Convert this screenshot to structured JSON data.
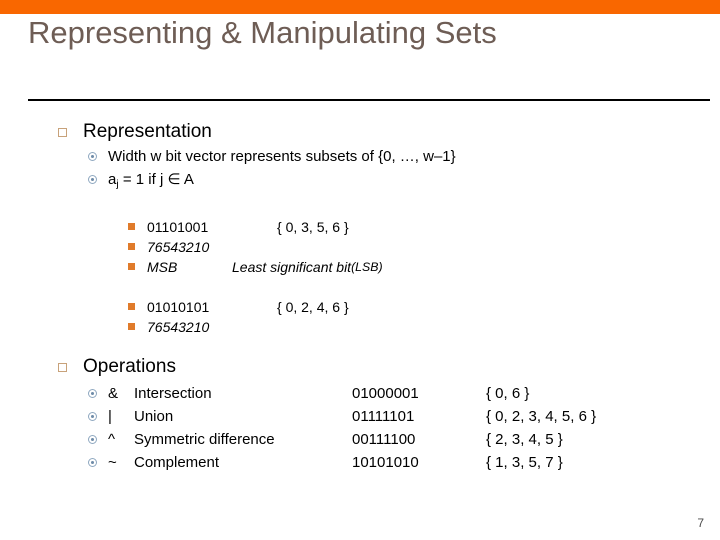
{
  "slide": {
    "title": "Representing & Manipulating Sets",
    "page_number": "7",
    "accent_color": "#F96700",
    "title_color": "#6E5D55",
    "highlight_color": "#B01818"
  },
  "sections": {
    "representation": {
      "heading": "Representation",
      "points": [
        "Width w bit vector represents subsets of {0, …, w–1}",
        "a"
      ],
      "point2_prefix": "a",
      "point2_subscript": "j",
      "point2_rest": " = 1 if j  ∈  A"
    },
    "examples": [
      {
        "bits": "01101001",
        "set": "{ 0, 3, 5, 6 }",
        "indices": "76543210",
        "msb_label": "MSB",
        "lsb_label": "Least significant bit ",
        "lsb_abbrev": "(LSB)"
      },
      {
        "bits": "01010101",
        "set": "{ 0, 2, 4, 6 }",
        "indices": "76543210"
      }
    ],
    "operations": {
      "heading": "Operations",
      "rows": [
        {
          "symbol": "&",
          "name": "Intersection",
          "bits": "01000001",
          "set": "{ 0, 6 }"
        },
        {
          "symbol": "|",
          "name": "Union",
          "bits": "01111101",
          "set": "{ 0, 2, 3, 4, 5, 6 }"
        },
        {
          "symbol": "^",
          "name": "Symmetric difference",
          "bits": "00111100",
          "set": "{ 2, 3, 4, 5 }"
        },
        {
          "symbol": "~",
          "name": "Complement",
          "bits": "10101010",
          "set": "{ 1, 3, 5, 7 }"
        }
      ]
    }
  }
}
